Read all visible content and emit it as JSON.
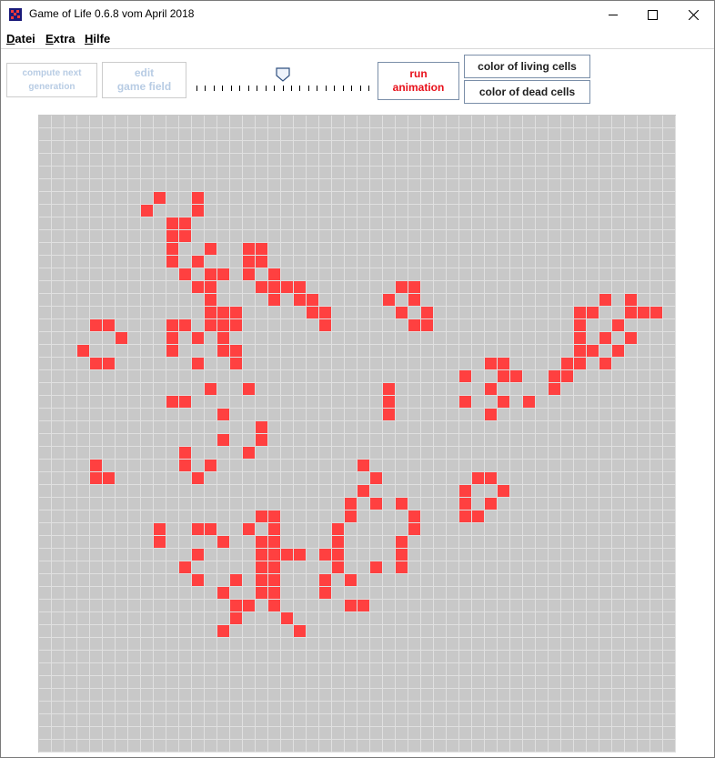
{
  "window": {
    "title": "Game of Life 0.6.8 vom April 2018",
    "controls": {
      "minimize": "—",
      "maximize": "☐",
      "close": "✕"
    }
  },
  "menu": {
    "items": [
      {
        "label": "Datei",
        "mnemonic": "D",
        "rest": "atei"
      },
      {
        "label": "Extra",
        "mnemonic": "E",
        "rest": "xtra"
      },
      {
        "label": "Hilfe",
        "mnemonic": "H",
        "rest": "ilfe"
      }
    ]
  },
  "toolbar": {
    "compute_next_line1": "compute next",
    "compute_next_line2": "generation",
    "edit_line1": "edit",
    "edit_line2": "game field",
    "run_line1": "run",
    "run_line2": "animation",
    "color_living": "color of living cells",
    "color_dead": "color of dead cells",
    "speed_slider_level": 0.5
  },
  "colors": {
    "living": "#ff4040",
    "dead": "#c8c8c8",
    "grid_line": "#e0e0e0"
  },
  "board": {
    "rows": 50,
    "cols": 50,
    "living_cells": [
      [
        6,
        9
      ],
      [
        6,
        12
      ],
      [
        7,
        8
      ],
      [
        7,
        12
      ],
      [
        8,
        10
      ],
      [
        8,
        11
      ],
      [
        9,
        10
      ],
      [
        9,
        11
      ],
      [
        10,
        10
      ],
      [
        10,
        13
      ],
      [
        10,
        16
      ],
      [
        10,
        17
      ],
      [
        11,
        10
      ],
      [
        11,
        12
      ],
      [
        11,
        16
      ],
      [
        11,
        17
      ],
      [
        12,
        11
      ],
      [
        12,
        13
      ],
      [
        12,
        14
      ],
      [
        12,
        16
      ],
      [
        12,
        18
      ],
      [
        13,
        12
      ],
      [
        13,
        13
      ],
      [
        13,
        17
      ],
      [
        13,
        18
      ],
      [
        13,
        19
      ],
      [
        13,
        20
      ],
      [
        13,
        28
      ],
      [
        13,
        29
      ],
      [
        14,
        13
      ],
      [
        14,
        18
      ],
      [
        14,
        20
      ],
      [
        14,
        21
      ],
      [
        14,
        27
      ],
      [
        14,
        29
      ],
      [
        14,
        44
      ],
      [
        14,
        46
      ],
      [
        15,
        13
      ],
      [
        15,
        14
      ],
      [
        15,
        15
      ],
      [
        15,
        21
      ],
      [
        15,
        22
      ],
      [
        15,
        28
      ],
      [
        15,
        30
      ],
      [
        15,
        42
      ],
      [
        15,
        43
      ],
      [
        15,
        46
      ],
      [
        15,
        47
      ],
      [
        15,
        48
      ],
      [
        16,
        4
      ],
      [
        16,
        5
      ],
      [
        16,
        10
      ],
      [
        16,
        11
      ],
      [
        16,
        13
      ],
      [
        16,
        14
      ],
      [
        16,
        15
      ],
      [
        16,
        22
      ],
      [
        16,
        29
      ],
      [
        16,
        30
      ],
      [
        16,
        42
      ],
      [
        16,
        45
      ],
      [
        17,
        6
      ],
      [
        17,
        10
      ],
      [
        17,
        12
      ],
      [
        17,
        14
      ],
      [
        17,
        42
      ],
      [
        17,
        44
      ],
      [
        17,
        46
      ],
      [
        18,
        3
      ],
      [
        18,
        10
      ],
      [
        18,
        14
      ],
      [
        18,
        15
      ],
      [
        18,
        42
      ],
      [
        18,
        43
      ],
      [
        18,
        45
      ],
      [
        19,
        4
      ],
      [
        19,
        5
      ],
      [
        19,
        12
      ],
      [
        19,
        15
      ],
      [
        19,
        35
      ],
      [
        19,
        36
      ],
      [
        19,
        41
      ],
      [
        19,
        42
      ],
      [
        19,
        44
      ],
      [
        20,
        33
      ],
      [
        20,
        36
      ],
      [
        20,
        37
      ],
      [
        20,
        40
      ],
      [
        20,
        41
      ],
      [
        21,
        13
      ],
      [
        21,
        16
      ],
      [
        21,
        27
      ],
      [
        21,
        35
      ],
      [
        21,
        40
      ],
      [
        22,
        10
      ],
      [
        22,
        11
      ],
      [
        22,
        27
      ],
      [
        22,
        33
      ],
      [
        22,
        36
      ],
      [
        22,
        38
      ],
      [
        23,
        14
      ],
      [
        23,
        27
      ],
      [
        23,
        35
      ],
      [
        24,
        17
      ],
      [
        25,
        14
      ],
      [
        25,
        17
      ],
      [
        26,
        11
      ],
      [
        26,
        16
      ],
      [
        27,
        4
      ],
      [
        27,
        11
      ],
      [
        27,
        13
      ],
      [
        27,
        25
      ],
      [
        28,
        4
      ],
      [
        28,
        5
      ],
      [
        28,
        12
      ],
      [
        28,
        26
      ],
      [
        28,
        34
      ],
      [
        28,
        35
      ],
      [
        29,
        25
      ],
      [
        29,
        33
      ],
      [
        29,
        36
      ],
      [
        30,
        24
      ],
      [
        30,
        26
      ],
      [
        30,
        28
      ],
      [
        30,
        33
      ],
      [
        30,
        35
      ],
      [
        31,
        17
      ],
      [
        31,
        18
      ],
      [
        31,
        24
      ],
      [
        31,
        29
      ],
      [
        31,
        33
      ],
      [
        31,
        34
      ],
      [
        32,
        9
      ],
      [
        32,
        12
      ],
      [
        32,
        13
      ],
      [
        32,
        16
      ],
      [
        32,
        18
      ],
      [
        32,
        23
      ],
      [
        32,
        29
      ],
      [
        33,
        9
      ],
      [
        33,
        14
      ],
      [
        33,
        17
      ],
      [
        33,
        18
      ],
      [
        33,
        23
      ],
      [
        33,
        28
      ],
      [
        34,
        12
      ],
      [
        34,
        17
      ],
      [
        34,
        18
      ],
      [
        34,
        19
      ],
      [
        34,
        20
      ],
      [
        34,
        22
      ],
      [
        34,
        23
      ],
      [
        34,
        28
      ],
      [
        35,
        11
      ],
      [
        35,
        17
      ],
      [
        35,
        18
      ],
      [
        35,
        23
      ],
      [
        35,
        26
      ],
      [
        35,
        28
      ],
      [
        36,
        12
      ],
      [
        36,
        15
      ],
      [
        36,
        17
      ],
      [
        36,
        18
      ],
      [
        36,
        22
      ],
      [
        36,
        24
      ],
      [
        37,
        14
      ],
      [
        37,
        17
      ],
      [
        37,
        18
      ],
      [
        37,
        22
      ],
      [
        38,
        15
      ],
      [
        38,
        16
      ],
      [
        38,
        18
      ],
      [
        38,
        24
      ],
      [
        38,
        25
      ],
      [
        39,
        15
      ],
      [
        39,
        19
      ],
      [
        40,
        14
      ],
      [
        40,
        20
      ]
    ]
  }
}
